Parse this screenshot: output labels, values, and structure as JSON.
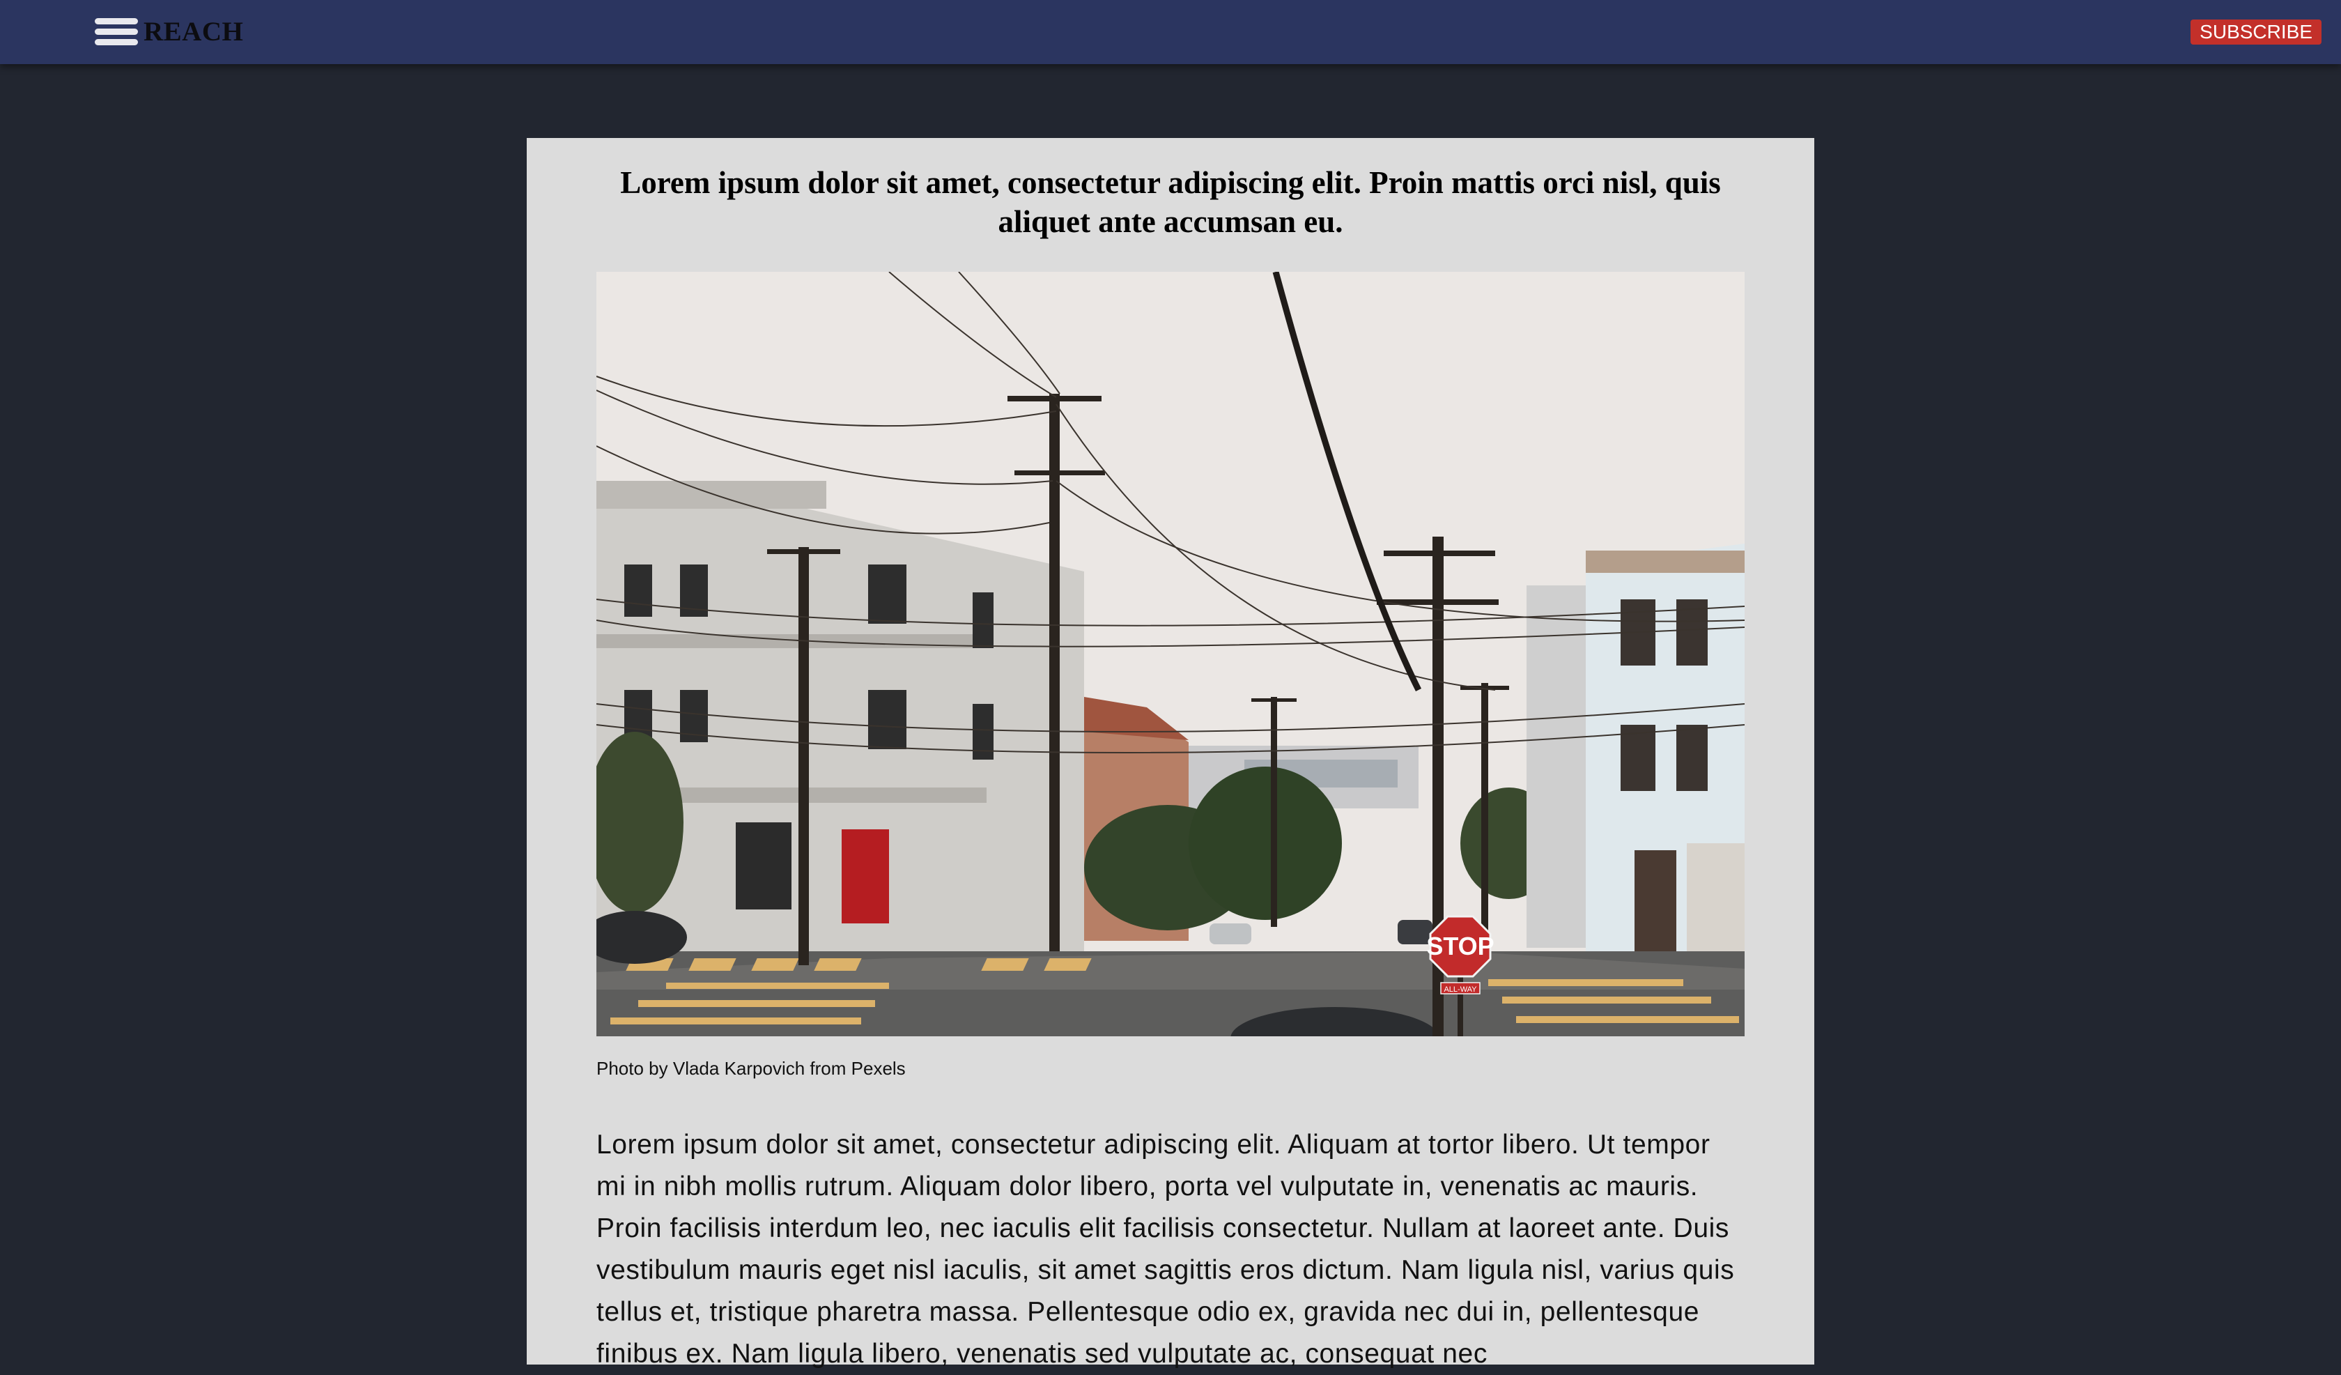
{
  "header": {
    "menu_icon": "hamburger-menu-icon",
    "brand": "REACH",
    "subscribe_label": "SUBSCRIBE",
    "colors": {
      "bar": "#2b3560",
      "subscribe": "#c3302a"
    }
  },
  "article": {
    "title": "Lorem ipsum dolor sit amet, consectetur adipiscing elit. Proin mattis orci nisl, quis aliquet ante accumsan eu.",
    "image": {
      "stop_sign_text": "STOP",
      "all_way_text": "ALL-WAY"
    },
    "caption": "Photo by Vlada Karpovich from Pexels",
    "body": "Lorem ipsum dolor sit amet, consectetur adipiscing elit. Aliquam at tortor libero. Ut tempor mi in nibh mollis rutrum. Aliquam dolor libero, porta vel vulputate in, venenatis ac mauris. Proin facilisis interdum leo, nec iaculis elit facilisis consectetur. Nullam at laoreet ante. Duis vestibulum mauris eget nisl iaculis, sit amet sagittis eros dictum. Nam ligula nisl, varius quis tellus et, tristique pharetra massa. Pellentesque odio ex, gravida nec dui in, pellentesque finibus ex. Nam ligula libero, venenatis sed vulputate ac, consequat nec"
  },
  "colors": {
    "page_background": "#222630",
    "article_background": "#dcdcdc"
  }
}
